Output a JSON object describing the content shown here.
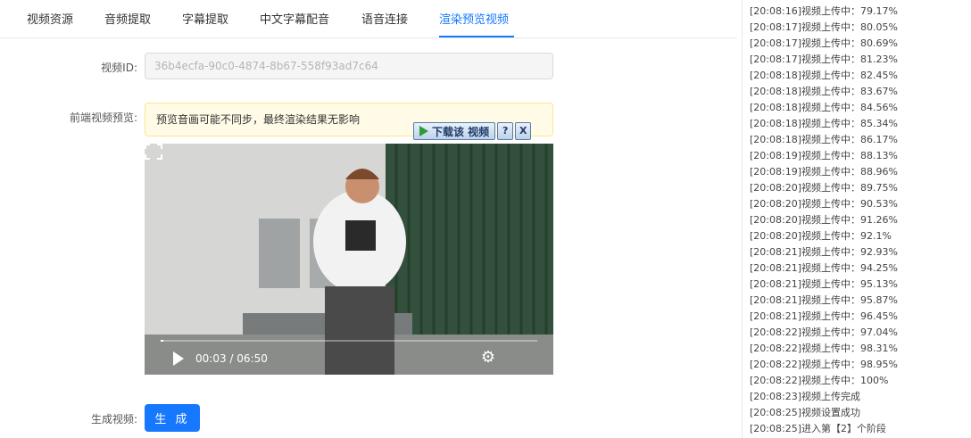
{
  "tabs": [
    {
      "label": "视频资源",
      "active": false
    },
    {
      "label": "音频提取",
      "active": false
    },
    {
      "label": "字幕提取",
      "active": false
    },
    {
      "label": "中文字幕配音",
      "active": false
    },
    {
      "label": "语音连接",
      "active": false
    },
    {
      "label": "渲染预览视频",
      "active": true
    }
  ],
  "form": {
    "video_id_label": "视频ID:",
    "video_id_value": "36b4ecfa-90c0-4874-8b67-558f93ad7c64",
    "preview_label": "前端视频预览:",
    "alert_text": "预览音画可能不同步，最终渲染结果无影响",
    "generate_label": "生成视频:",
    "generate_button": "生 成"
  },
  "download_toolbar": {
    "label": "下载该 视频",
    "help": "?",
    "close": "X"
  },
  "video_player": {
    "time": "00:03 / 06:50",
    "progress_fraction": 0.0073,
    "icons": [
      "play-icon",
      "gear-icon",
      "fullscreen-icon"
    ]
  },
  "log": [
    "[20:08:16]视频上传中：79.17%",
    "[20:08:17]视频上传中：80.05%",
    "[20:08:17]视频上传中：80.69%",
    "[20:08:17]视频上传中：81.23%",
    "[20:08:18]视频上传中：82.45%",
    "[20:08:18]视频上传中：83.67%",
    "[20:08:18]视频上传中：84.56%",
    "[20:08:18]视频上传中：85.34%",
    "[20:08:18]视频上传中：86.17%",
    "[20:08:19]视频上传中：88.13%",
    "[20:08:19]视频上传中：88.96%",
    "[20:08:20]视频上传中：89.75%",
    "[20:08:20]视频上传中：90.53%",
    "[20:08:20]视频上传中：91.26%",
    "[20:08:20]视频上传中：92.1%",
    "[20:08:21]视频上传中：92.93%",
    "[20:08:21]视频上传中：94.25%",
    "[20:08:21]视频上传中：95.13%",
    "[20:08:21]视频上传中：95.87%",
    "[20:08:21]视频上传中：96.45%",
    "[20:08:22]视频上传中：97.04%",
    "[20:08:22]视频上传中：98.31%",
    "[20:08:22]视频上传中：98.95%",
    "[20:08:22]视频上传中：100%",
    "[20:08:23]视频上传完成",
    "[20:08:25]视频设置成功",
    "[20:08:25]进入第【2】个阶段"
  ],
  "colors": {
    "accent": "#1677ff",
    "alert_bg": "#fffbe6",
    "alert_border": "#ffe58f"
  }
}
